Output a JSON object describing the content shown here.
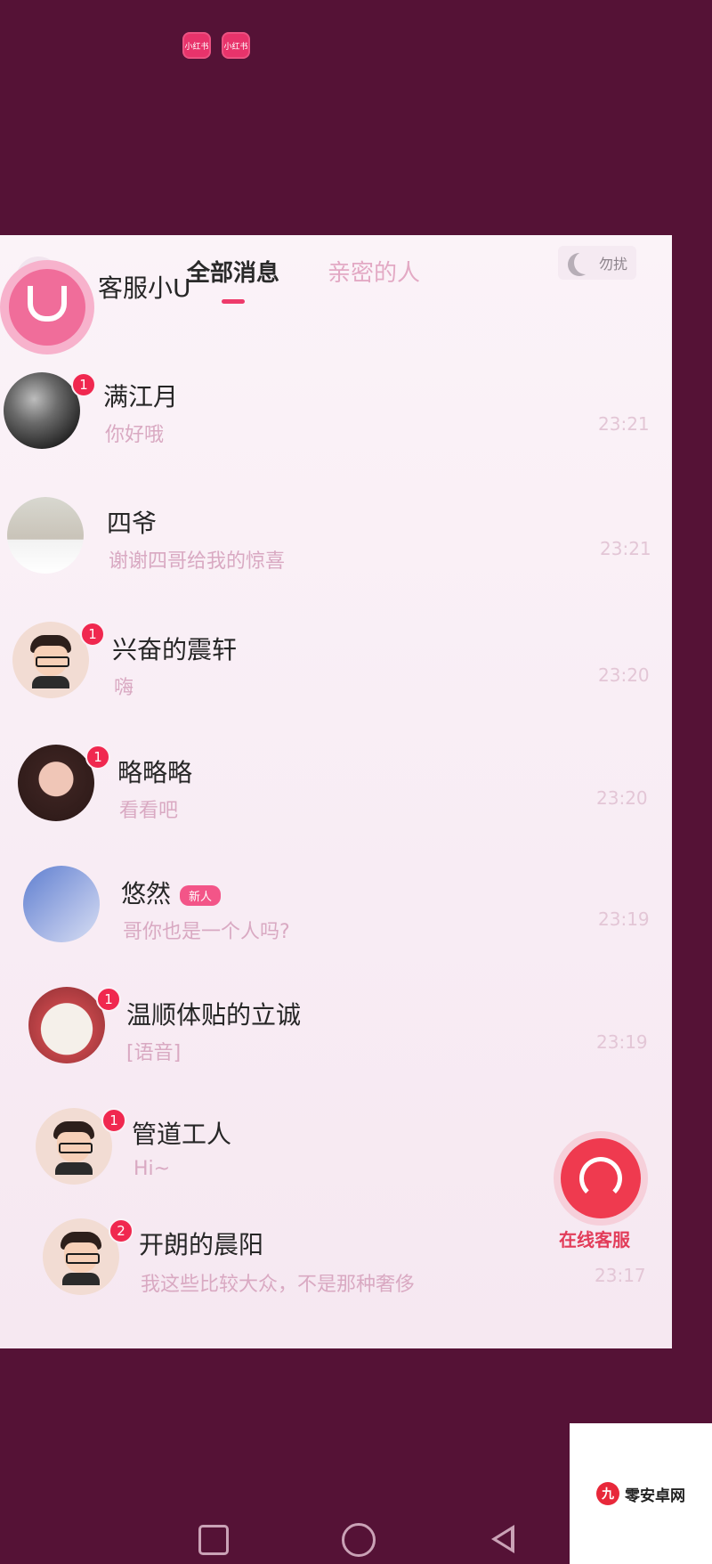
{
  "status": {
    "badges": [
      "小红书",
      "小红书"
    ]
  },
  "header": {
    "tab_all": "全部消息",
    "tab_close": "亲密的人",
    "dnd_label": "勿扰"
  },
  "conversations": [
    {
      "name": "客服小U",
      "preview": "",
      "time": "",
      "unread": "",
      "avatar": "service-avatar",
      "new": false
    },
    {
      "name": "满江月",
      "preview": "你好哦",
      "time": "23:21",
      "unread": "1",
      "avatar": "night-scene-avatar",
      "new": false
    },
    {
      "name": "四爷",
      "preview": "谢谢四哥给我的惊喜",
      "time": "23:21",
      "unread": "",
      "avatar": "man-photo-avatar",
      "new": false
    },
    {
      "name": "兴奋的震轩",
      "preview": "嗨",
      "time": "23:20",
      "unread": "1",
      "avatar": "cartoon-man-avatar",
      "new": false
    },
    {
      "name": "略略略",
      "preview": "看看吧",
      "time": "23:20",
      "unread": "1",
      "avatar": "girl-avatar",
      "new": false
    },
    {
      "name": "悠然",
      "preview": "哥你也是一个人吗?",
      "time": "23:19",
      "unread": "",
      "avatar": "anime-avatar",
      "new": true,
      "new_label": "新人"
    },
    {
      "name": "温顺体贴的立诚",
      "preview": "[语音]",
      "time": "23:19",
      "unread": "1",
      "avatar": "dog-avatar",
      "new": false
    },
    {
      "name": "管道工人",
      "preview": "Hi~",
      "time": "",
      "unread": "1",
      "avatar": "cartoon-man-avatar",
      "new": false
    },
    {
      "name": "开朗的晨阳",
      "preview": "我这些比较大众，不是那种奢侈",
      "time": "23:17",
      "unread": "2",
      "avatar": "cartoon-man-avatar",
      "new": false
    }
  ],
  "customer_service": {
    "label": "在线客服"
  },
  "watermark": {
    "mark": "九",
    "text": "零安卓网"
  }
}
